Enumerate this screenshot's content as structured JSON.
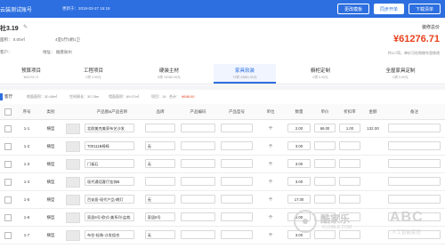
{
  "header": {
    "title": "云装测试账号",
    "saved_text": "更新于：2018-03-27 15:18",
    "buttons": [
      "更改模板",
      "同步开单",
      "下载清单"
    ]
  },
  "project": {
    "name": "社3.19",
    "area": "面积：  0.00㎡",
    "room": "4室0厅0厨1卫",
    "owner": "客户：",
    "address": "地址：  福建泉州",
    "total_label": "装修总价",
    "total_value": "¥61276.71",
    "summary": "共117项，单价可在购物车里修改"
  },
  "tabs": [
    {
      "name": "预算项目",
      "sub": "¥61276.71"
    },
    {
      "name": "工程项目",
      "sub": "0项  0.00元"
    },
    {
      "name": "硬装主材",
      "sub": "8项  10180.00元"
    },
    {
      "name": "家具软装",
      "sub": "73项  24851.00元"
    },
    {
      "name": "橱柜定制",
      "sub": "0项  0.00元"
    },
    {
      "name": "全屋家具定制",
      "sub": "0项  0.00元"
    }
  ],
  "stats": {
    "label": "客厅",
    "items": [
      "地面面积：30.48㎡",
      "空间周长：30.78m",
      "墙面面积：69.07㎡",
      "项目：19",
      "合计："
    ],
    "cost": "¥698.00"
  },
  "table": {
    "headers": [
      "序号",
      "类别",
      "产品图&产品名称",
      "品牌",
      "产品编码",
      "产品型号",
      "单位",
      "数量",
      "单价",
      "折扣率",
      "金额",
      "备注"
    ],
    "rows": [
      {
        "no": "1-1",
        "cat": "横型",
        "name": "北欧美克美家布艺沙发",
        "brand": "",
        "code": "",
        "model": "",
        "unit": "个",
        "qty": "2.00",
        "price": "66.00",
        "disc": "1.00",
        "amount": "132.00",
        "note": ""
      },
      {
        "no": "1-2",
        "cat": "横型",
        "name": "T00111B椅椅",
        "brand": "无",
        "code": "",
        "model": "",
        "unit": "个",
        "qty": "3.00",
        "price": "",
        "disc": "",
        "amount": "",
        "note": ""
      },
      {
        "no": "1-3",
        "cat": "横型",
        "name": "门板石",
        "brand": "无",
        "code": "",
        "model": "",
        "unit": "个",
        "qty": "3.00",
        "price": "",
        "disc": "",
        "amount": "",
        "note": ""
      },
      {
        "no": "1-4",
        "cat": "横型",
        "name": "现代通话客厅挂饰B",
        "brand": "",
        "code": "",
        "model": "",
        "unit": "个",
        "qty": "3.00",
        "price": "",
        "disc": "",
        "amount": "",
        "note": ""
      },
      {
        "no": "1-5",
        "cat": "横型",
        "name": "百安居-现代产品-朗灯",
        "brand": "无",
        "code": "",
        "model": "",
        "unit": "个",
        "qty": "17.00",
        "price": "",
        "disc": "",
        "amount": "",
        "note": ""
      },
      {
        "no": "1-6",
        "cat": "横型",
        "name": "家居6号-欧式-美系列-盆栽",
        "brand": "家居6号",
        "code": "",
        "model": "",
        "unit": "个",
        "qty": "2.00",
        "price": "",
        "disc": "",
        "amount": "",
        "note": ""
      },
      {
        "no": "1-7",
        "cat": "横型",
        "name": "布住-轻装-沙发组合",
        "brand": "无",
        "code": "",
        "model": "",
        "unit": "个",
        "qty": "3.00",
        "price": "",
        "disc": "",
        "amount": "",
        "note": ""
      }
    ]
  },
  "watermark": {
    "brand1": "酷家乐",
    "brand1_sub": "KUJIALE.COM",
    "brand2": "ABC",
    "brand2_sub": "人工智能家居"
  },
  "colors": {
    "accent": "#2d6fe0",
    "price": "#e8401c"
  }
}
